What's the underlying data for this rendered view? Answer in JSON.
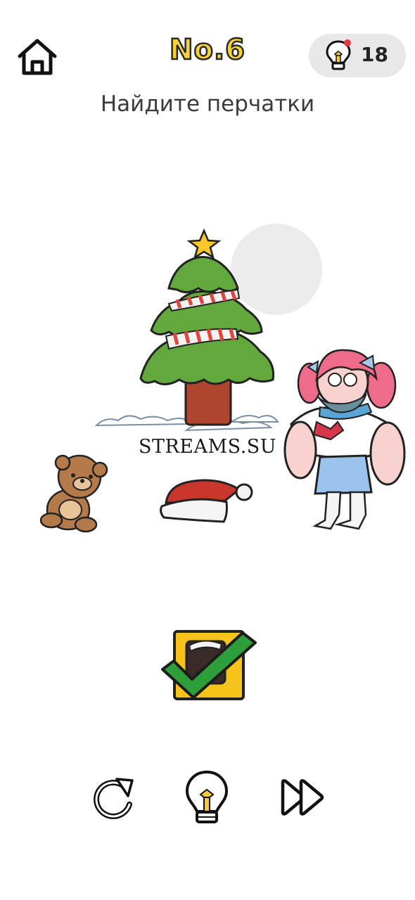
{
  "header": {
    "level_label": "No.6",
    "hints_count": "18"
  },
  "task": {
    "prompt": "Найдите перчатки"
  },
  "watermark": "STREAMS.SU",
  "icons": {
    "home": "home-icon",
    "hint": "lightbulb-icon",
    "restart": "restart-icon",
    "skip": "skip-icon",
    "found": "checkmark-icon"
  },
  "colors": {
    "title_fill": "#f5d13a",
    "check_green": "#2e9e3a",
    "found_tile": "#f6c21c",
    "bulb_yellow": "#f5c842"
  }
}
